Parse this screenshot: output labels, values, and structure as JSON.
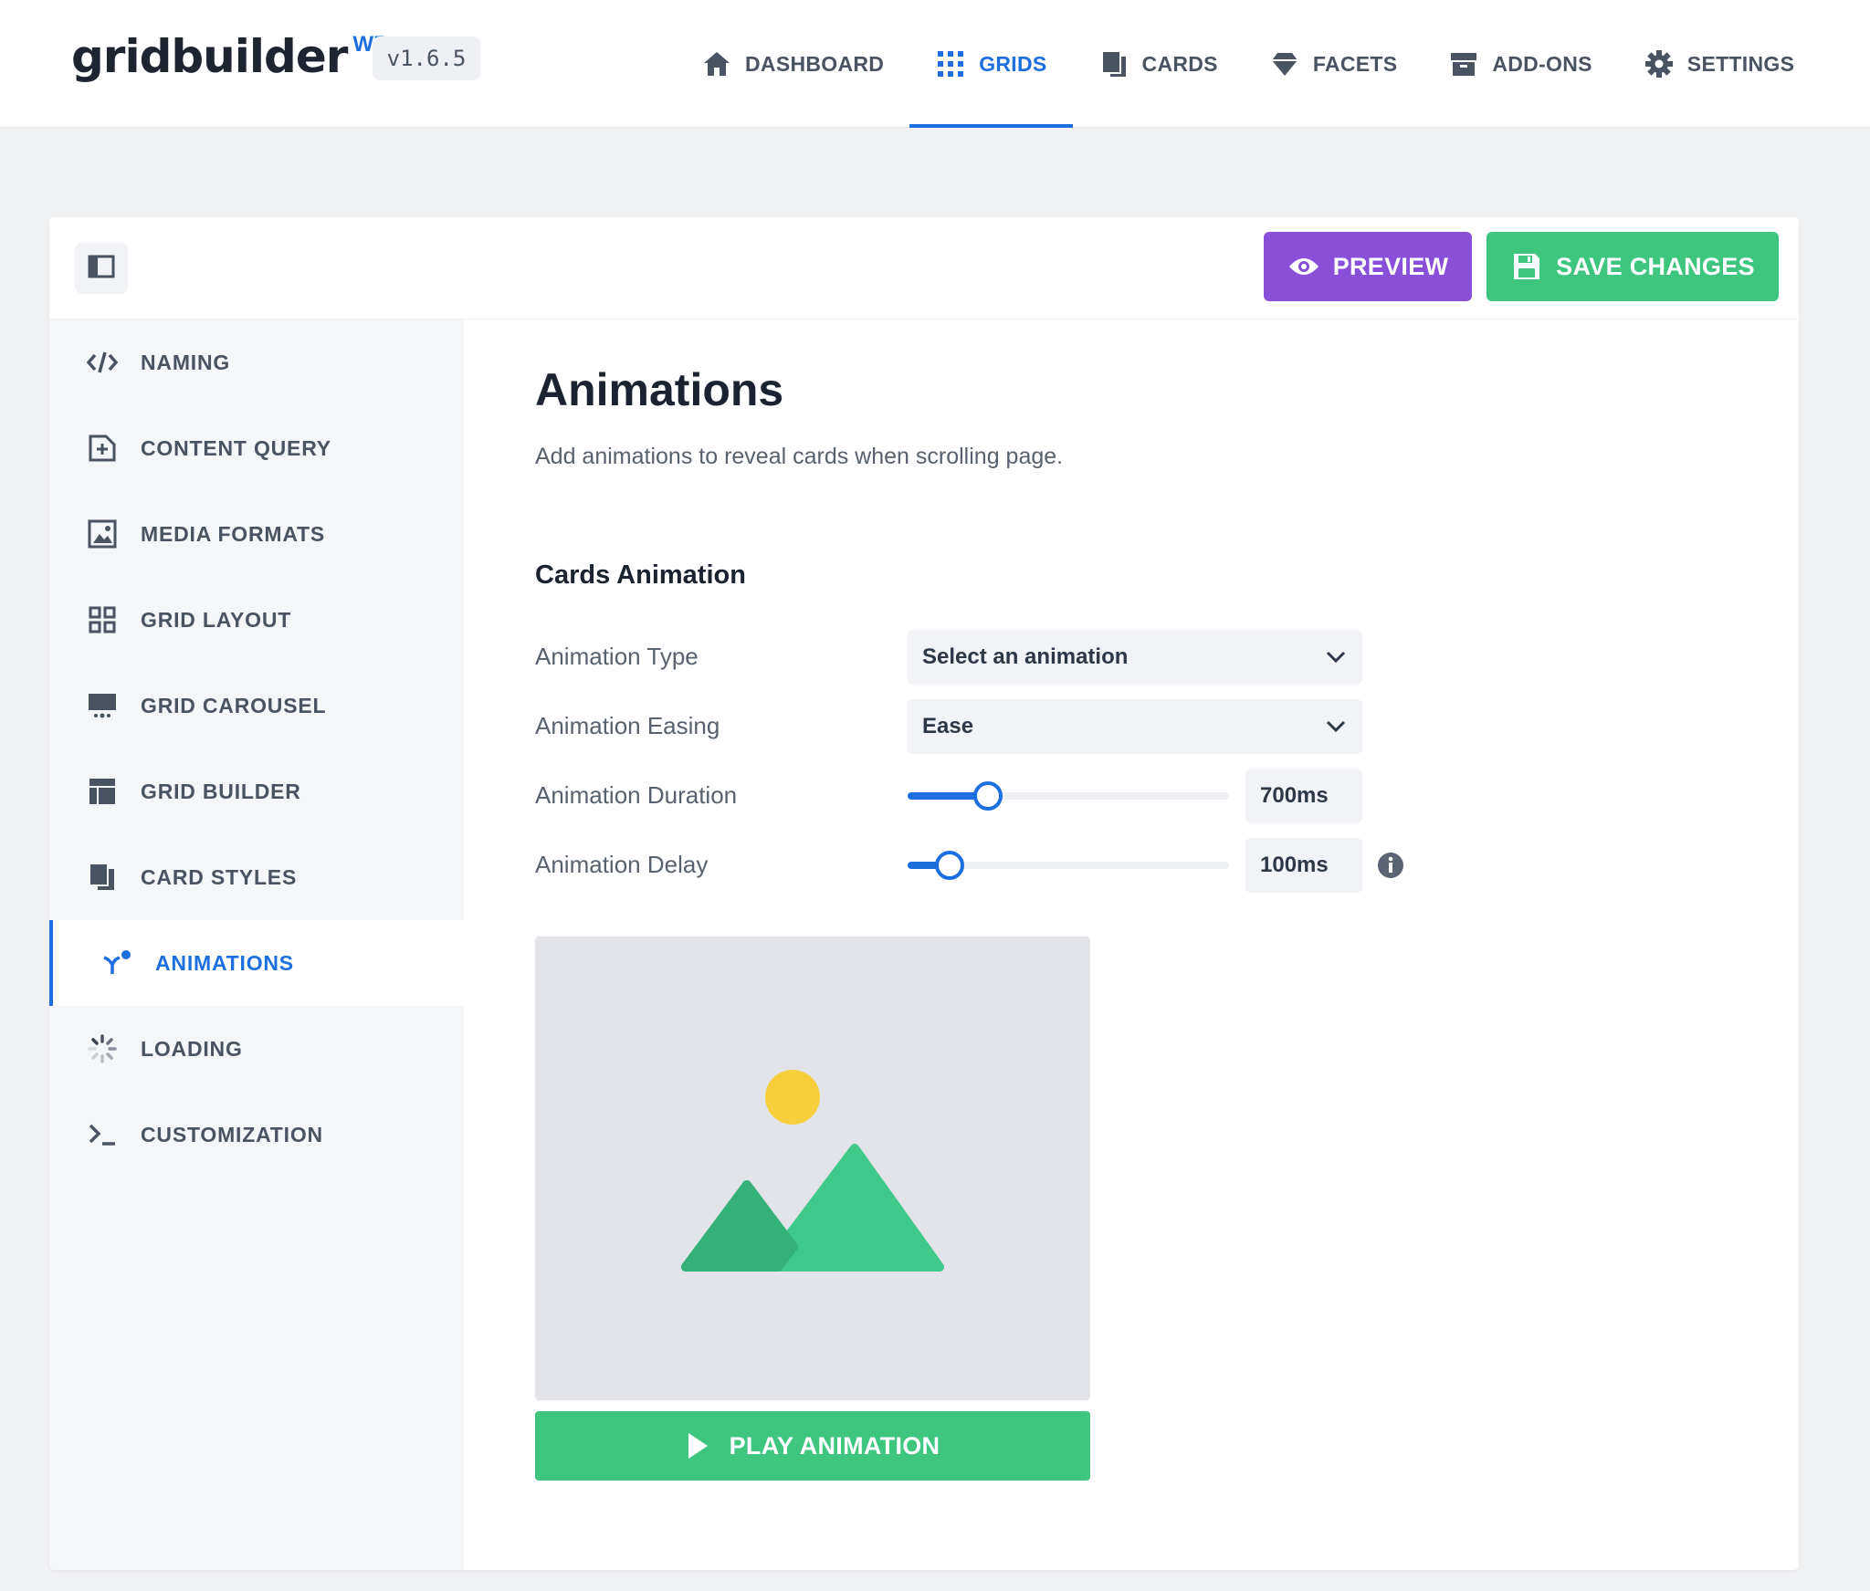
{
  "brand": {
    "name": "gridbuilder",
    "sup": "WP",
    "version": "v1.6.5"
  },
  "nav": [
    {
      "label": "DASHBOARD",
      "icon": "home-icon"
    },
    {
      "label": "GRIDS",
      "icon": "grid-dots-icon",
      "active": true
    },
    {
      "label": "CARDS",
      "icon": "cards-icon"
    },
    {
      "label": "FACETS",
      "icon": "diamond-icon"
    },
    {
      "label": "ADD-ONS",
      "icon": "archive-icon"
    },
    {
      "label": "SETTINGS",
      "icon": "gear-icon"
    }
  ],
  "toolbar": {
    "preview_label": "PREVIEW",
    "save_label": "SAVE CHANGES"
  },
  "sidebar": {
    "items": [
      {
        "label": "NAMING",
        "icon": "code-icon"
      },
      {
        "label": "CONTENT QUERY",
        "icon": "folder-plus-icon"
      },
      {
        "label": "MEDIA FORMATS",
        "icon": "image-icon"
      },
      {
        "label": "GRID LAYOUT",
        "icon": "layout-grid-icon"
      },
      {
        "label": "GRID CAROUSEL",
        "icon": "carousel-icon"
      },
      {
        "label": "GRID BUILDER",
        "icon": "builder-icon"
      },
      {
        "label": "CARD STYLES",
        "icon": "card-styles-icon"
      },
      {
        "label": "ANIMATIONS",
        "icon": "animation-icon",
        "active": true
      },
      {
        "label": "LOADING",
        "icon": "spinner-icon"
      },
      {
        "label": "CUSTOMIZATION",
        "icon": "terminal-icon"
      }
    ]
  },
  "main": {
    "title": "Animations",
    "description": "Add animations to reveal cards when scrolling page.",
    "section_title": "Cards Animation",
    "fields": {
      "type": {
        "label": "Animation Type",
        "value": "Select an animation"
      },
      "easing": {
        "label": "Animation Easing",
        "value": "Ease"
      },
      "duration": {
        "label": "Animation Duration",
        "value": "700ms",
        "level": 0.25
      },
      "delay": {
        "label": "Animation Delay",
        "value": "100ms",
        "level": 0.13
      }
    },
    "play_label": "PLAY ANIMATION"
  },
  "colors": {
    "accent": "#1d6fe0",
    "preview": "#8a4fd8",
    "success": "#3ec67f",
    "sun": "#f7cf3c",
    "mountain": "#3ec889"
  }
}
